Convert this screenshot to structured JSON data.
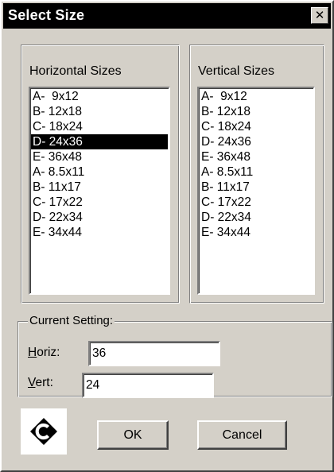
{
  "window": {
    "title": "Select Size",
    "close_glyph": "✕"
  },
  "horizontal": {
    "label": "Horizontal Sizes",
    "items": [
      "A-  9x12",
      "B- 12x18",
      "C- 18x24",
      "D- 24x36",
      "E- 36x48",
      "A- 8.5x11",
      "B- 11x17",
      "C- 17x22",
      "D- 22x34",
      "E- 34x44"
    ],
    "selected_index": 3
  },
  "vertical": {
    "label": "Vertical Sizes",
    "items": [
      "A-  9x12",
      "B- 12x18",
      "C- 18x24",
      "D- 24x36",
      "E- 36x48",
      "A- 8.5x11",
      "B- 11x17",
      "C- 17x22",
      "D- 22x34",
      "E- 34x44"
    ]
  },
  "current_setting": {
    "legend": "Current Setting:",
    "horiz_label_mnemonic": "H",
    "horiz_label_rest": "oriz:",
    "horiz_value": "36",
    "vert_label_mnemonic": "V",
    "vert_label_rest": "ert:",
    "vert_value": "24"
  },
  "buttons": {
    "ok": "OK",
    "cancel": "Cancel"
  },
  "logo": {
    "icon": "c-diamond-logo-icon",
    "colors": {
      "fill": "#000000",
      "background": "#ffffff"
    }
  }
}
